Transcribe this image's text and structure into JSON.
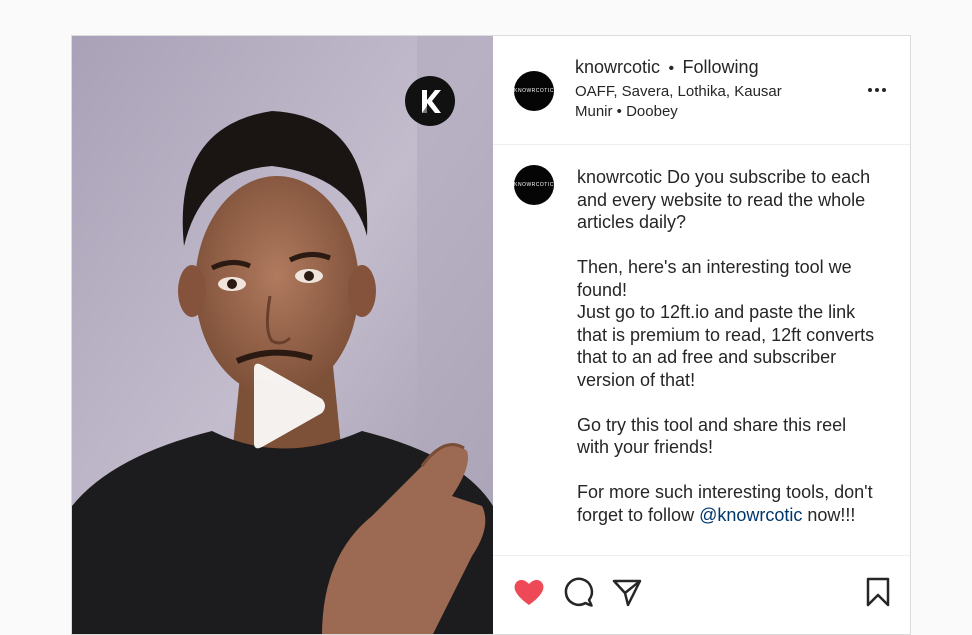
{
  "post": {
    "media": {
      "play_icon": "play-icon",
      "badge_letter": "K"
    },
    "header": {
      "username": "knowrcotic",
      "separator": "•",
      "follow_status": "Following",
      "audio_line1": "OAFF, Savera, Lothika, Kausar",
      "audio_line2": "Munir • Doobey",
      "avatar_text": "KNOWRCOTIC",
      "more_icon": "more-options-icon"
    },
    "caption": {
      "username": "knowrcotic",
      "line1": "Do you subscribe to each and every website to read the whole articles daily?",
      "line2": "Then, here's an interesting tool we found!",
      "line3": "Just go to 12ft.io and paste the link that is premium to read, 12ft converts that to an ad free and subscriber version of that!",
      "line4": "Go try this tool and share this reel with your friends!",
      "line5_before": "For more such interesting tools, don't forget to follow",
      "line5_mention": "@knowrcotic",
      "line5_after": "now!!!",
      "avatar_text": "KNOWRCOTIC"
    },
    "actions": {
      "like_icon": "heart-icon",
      "liked": true,
      "like_color": "#ed4956",
      "comment_icon": "comment-icon",
      "share_icon": "share-icon",
      "save_icon": "bookmark-icon"
    }
  }
}
